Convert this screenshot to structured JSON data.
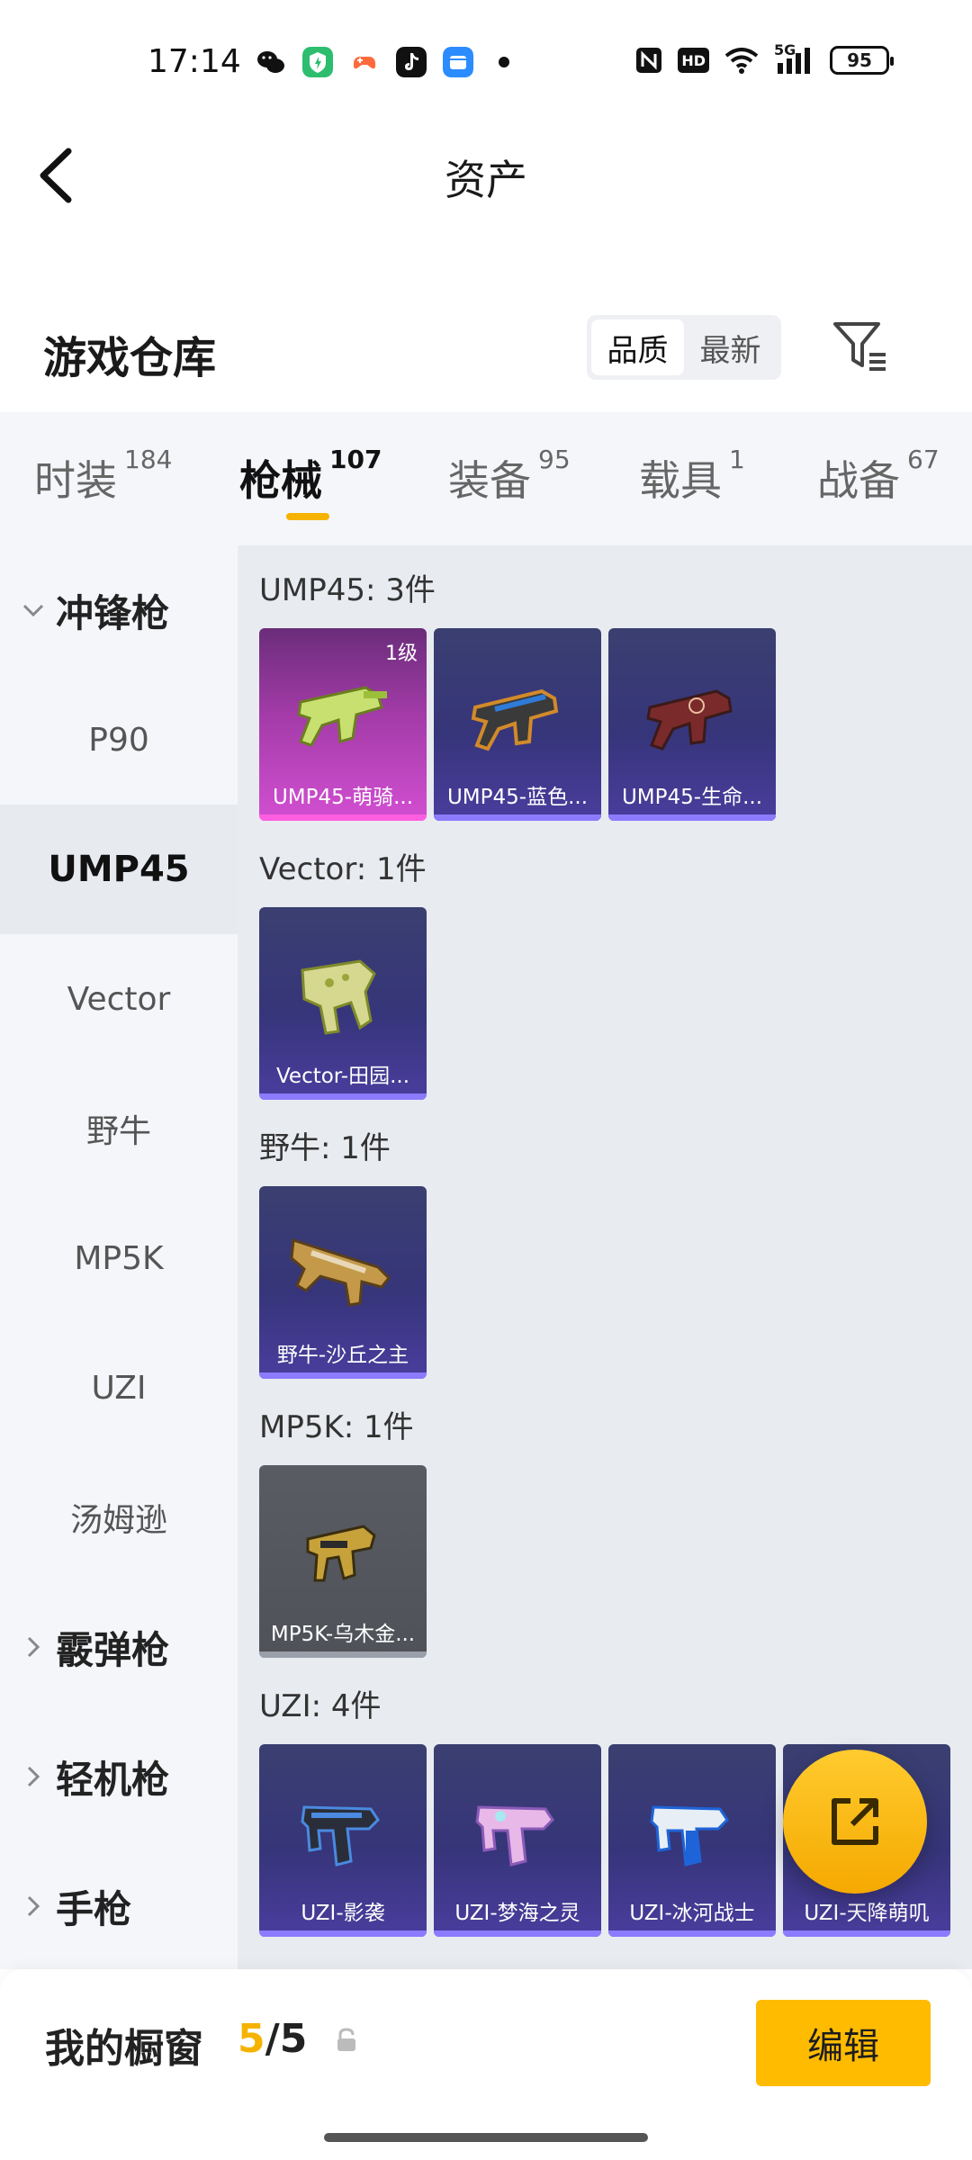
{
  "status_bar": {
    "time": "17:14",
    "network": "5G",
    "battery": "95",
    "hd": "HD"
  },
  "header": {
    "title": "资产"
  },
  "section": {
    "title": "游戏仓库",
    "sort_options": [
      "品质",
      "最新"
    ],
    "sort_selected": "品质"
  },
  "category_tabs": [
    {
      "label": "时装",
      "count": "184"
    },
    {
      "label": "枪械",
      "count": "107"
    },
    {
      "label": "装备",
      "count": "95"
    },
    {
      "label": "载具",
      "count": "1"
    },
    {
      "label": "战备",
      "count": "67"
    }
  ],
  "active_tab": "枪械",
  "sidebar": {
    "groups": [
      {
        "label": "冲锋枪",
        "expanded": true
      },
      {
        "label": "霰弹枪",
        "expanded": false
      },
      {
        "label": "轻机枪",
        "expanded": false
      },
      {
        "label": "手枪",
        "expanded": false
      }
    ],
    "items": [
      "P90",
      "UMP45",
      "Vector",
      "野牛",
      "MP5K",
      "UZI",
      "汤姆逊"
    ],
    "selected": "UMP45"
  },
  "content": {
    "groups": [
      {
        "title": "UMP45: 3件",
        "items": [
          {
            "name": "UMP45-萌骑...",
            "level": "1级",
            "rarity": "pink"
          },
          {
            "name": "UMP45-蓝色...",
            "rarity": "purple"
          },
          {
            "name": "UMP45-生命...",
            "rarity": "purple"
          }
        ]
      },
      {
        "title": "Vector: 1件",
        "items": [
          {
            "name": "Vector-田园...",
            "rarity": "purple"
          }
        ]
      },
      {
        "title": "野牛: 1件",
        "items": [
          {
            "name": "野牛-沙丘之主",
            "rarity": "purple"
          }
        ]
      },
      {
        "title": "MP5K: 1件",
        "items": [
          {
            "name": "MP5K-乌木金...",
            "rarity": "grey"
          }
        ]
      },
      {
        "title": "UZI: 4件",
        "items": [
          {
            "name": "UZI-影袭",
            "rarity": "purple"
          },
          {
            "name": "UZI-梦海之灵",
            "rarity": "purple"
          },
          {
            "name": "UZI-冰河战士",
            "rarity": "purple"
          },
          {
            "name": "UZI-天降萌叽",
            "rarity": "purple"
          }
        ]
      }
    ]
  },
  "bottom_bar": {
    "label": "我的橱窗",
    "current": "5",
    "separator": "/",
    "total": "5",
    "edit_label": "编辑"
  },
  "colors": {
    "accent": "#f5b300",
    "rarity_pink": "#d24fd2",
    "rarity_purple": "#4b3d9e",
    "rarity_grey": "#595c63"
  }
}
